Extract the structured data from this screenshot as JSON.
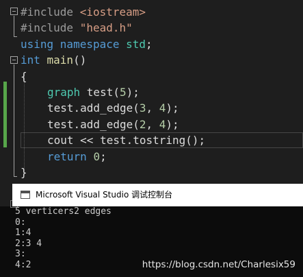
{
  "editor": {
    "lines": [
      [
        {
          "c": "pp",
          "t": "#include "
        },
        {
          "c": "str",
          "t": "<iostream>"
        }
      ],
      [
        {
          "c": "pp",
          "t": "#include "
        },
        {
          "c": "str",
          "t": "\"head.h\""
        }
      ],
      [
        {
          "c": "kw",
          "t": "using namespace "
        },
        {
          "c": "ns",
          "t": "std"
        },
        {
          "c": "plain",
          "t": ";"
        }
      ],
      [
        {
          "c": "kw",
          "t": "int "
        },
        {
          "c": "fn",
          "t": "main"
        },
        {
          "c": "plain",
          "t": "()"
        }
      ],
      [
        {
          "c": "plain",
          "t": "{"
        }
      ],
      [
        {
          "c": "type",
          "t": "graph "
        },
        {
          "c": "plain",
          "t": "test("
        },
        {
          "c": "num",
          "t": "5"
        },
        {
          "c": "plain",
          "t": ");"
        }
      ],
      [
        {
          "c": "plain",
          "t": "test.add_edge("
        },
        {
          "c": "num",
          "t": "3"
        },
        {
          "c": "plain",
          "t": ", "
        },
        {
          "c": "num",
          "t": "4"
        },
        {
          "c": "plain",
          "t": ");"
        }
      ],
      [
        {
          "c": "plain",
          "t": "test.add_edge("
        },
        {
          "c": "num",
          "t": "2"
        },
        {
          "c": "plain",
          "t": ", "
        },
        {
          "c": "num",
          "t": "4"
        },
        {
          "c": "plain",
          "t": ");"
        }
      ],
      [
        {
          "c": "plain",
          "t": "cout << test.tostring();"
        }
      ],
      [
        {
          "c": "kw",
          "t": "return "
        },
        {
          "c": "num",
          "t": "0"
        },
        {
          "c": "plain",
          "t": ";"
        }
      ],
      [
        {
          "c": "plain",
          "t": "}"
        }
      ]
    ]
  },
  "console": {
    "title": "Microsoft Visual Studio 调试控制台",
    "output": [
      "5 verticers2 edges",
      "0:",
      "1:4",
      "2:3 4",
      "3:",
      "4:2"
    ]
  },
  "watermark": "https://blog.csdn.net/Charlesix59",
  "colors": {
    "editor_bg": "#1e1e1e",
    "keyword": "#569cd6",
    "string": "#d69d85",
    "type": "#4ec9b0",
    "number": "#b5cea8",
    "change_bar": "#57a64a",
    "console_bg": "#0c0c0c"
  }
}
